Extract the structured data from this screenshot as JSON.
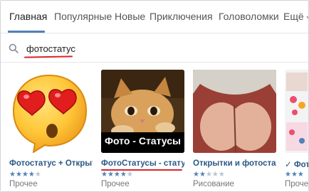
{
  "tabs": [
    {
      "label": "Главная",
      "active": true
    },
    {
      "label": "Популярные",
      "active": false
    },
    {
      "label": "Новые",
      "active": false
    },
    {
      "label": "Приключения",
      "active": false
    },
    {
      "label": "Головоломки",
      "active": false
    },
    {
      "label": "Ещё",
      "active": false
    }
  ],
  "search": {
    "value": "фотостатус",
    "icon": "search-icon"
  },
  "cards": [
    {
      "title": "Фотостатус + Открытки",
      "rating": 4,
      "category": "Прочее"
    },
    {
      "title": "ФотоСтатусы - статусы",
      "rating": 4,
      "category": "Прочее",
      "banner": "Фото - Статусы"
    },
    {
      "title": "Открытки и фотостатусы",
      "rating": 2,
      "category": "Рисование"
    },
    {
      "title": "✓ Фото",
      "rating": 3,
      "category": "Прочее"
    }
  ],
  "colors": {
    "accent": "#5181b8",
    "link": "#2a5885",
    "annotation_red": "#d8242b"
  }
}
